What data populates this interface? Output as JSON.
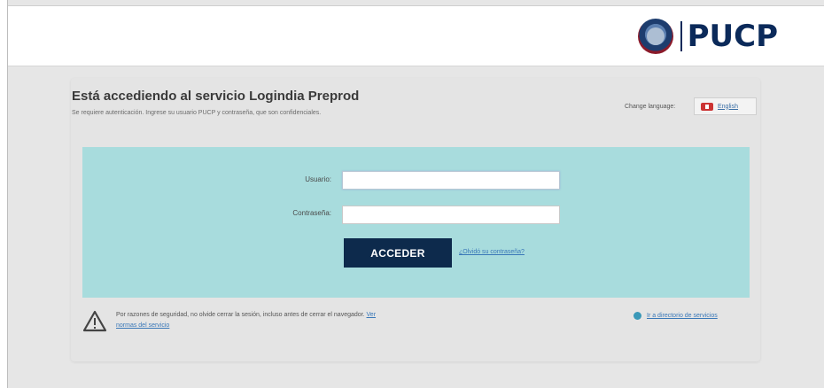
{
  "header": {
    "logo_text": "PUCP"
  },
  "page": {
    "title": "Está accediendo al servicio Logindia Preprod",
    "subtitle": "Se requiere autenticación. Ingrese su usuario PUCP y contraseña, que son confidenciales."
  },
  "language": {
    "label": "Change language:",
    "option": "English"
  },
  "form": {
    "username_label": "Usuario:",
    "username_value": "",
    "password_label": "Contraseña:",
    "password_value": "",
    "submit_label": "ACCEDER",
    "forgot_link": "¿Olvidó su contraseña?"
  },
  "footer": {
    "warning_text": "Por razones de seguridad, no olvide cerrar la sesión, incluso antes de cerrar el navegador.",
    "warning_link": "Ver normas del servicio",
    "directory_link": "Ir a directorio de servicios"
  },
  "colors": {
    "brand_navy": "#0d2a4c",
    "login_panel": "#a8dcdd",
    "link": "#3a78b8"
  }
}
